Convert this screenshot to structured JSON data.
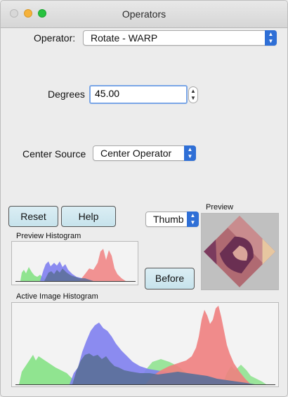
{
  "window": {
    "title": "Operators"
  },
  "operator": {
    "label": "Operator:",
    "selected": "Rotate - WARP"
  },
  "degrees": {
    "label": "Degrees",
    "value": "45.00"
  },
  "center_source": {
    "label": "Center Source",
    "selected": "Center Operator"
  },
  "buttons": {
    "reset": "Reset",
    "help": "Help",
    "before": "Before"
  },
  "thumb": {
    "selected": "Thumb"
  },
  "preview": {
    "label": "Preview"
  },
  "preview_histogram": {
    "label": "Preview Histogram"
  },
  "active_histogram": {
    "label": "Active Image Histogram"
  },
  "colors": {
    "accent": "#2f6fd6",
    "hist_red": "#f08080",
    "hist_green": "#7ee07e",
    "hist_blue": "#7f7ff0",
    "hist_overlap": "#5a6f98",
    "button_fill": "#cfe8ef"
  }
}
